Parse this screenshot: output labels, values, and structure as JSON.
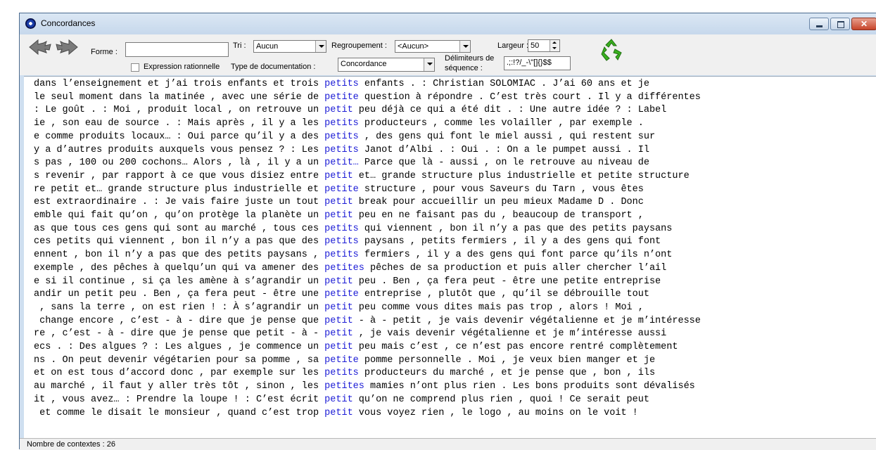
{
  "window": {
    "title": "Concordances"
  },
  "toolbar": {
    "forme_label": "Forme :",
    "forme_value": "",
    "tri_label": "Tri :",
    "tri_value": "Aucun",
    "regroupement_label": "Regroupement :",
    "regroupement_value": "<Aucun>",
    "largeur_label": "Largeur :",
    "largeur_value": "50",
    "regex_label": "Expression rationnelle",
    "doc_type_label": "Type de documentation :",
    "doc_type_value": "Concordance",
    "delim_label_1": "Délimiteurs de",
    "delim_label_2": "séquence :",
    "delim_value": ".;:!?/_-\\\"[]{}$$",
    "icons": [
      "back-arrow-icon",
      "forward-arrow-icon",
      "recycle-icon"
    ]
  },
  "concordances": [
    {
      "left": "dans l’enseignement et j’ai trois enfants et trois ",
      "kw": "petits",
      "right": " enfants . : Christian SOLOMIAC . J’ai 60 ans et je"
    },
    {
      "left": "le seul moment dans la matinée , avec une série de ",
      "kw": "petite",
      "right": " question à répondre . C’est très court . Il y a différentes"
    },
    {
      "left": ": Le goût . : Moi , produit local , on retrouve un ",
      "kw": "petit",
      "right": " peu déjà ce qui a été dit . : Une autre idée ? : Label"
    },
    {
      "left": "ie , son eau de source . : Mais après , il y a les ",
      "kw": "petits",
      "right": " producteurs , comme les volailler , par exemple ."
    },
    {
      "left": "e comme produits locaux… : Oui parce qu’il y a des ",
      "kw": "petits",
      "right": " , des gens qui font le miel aussi , qui restent sur"
    },
    {
      "left": "y a d’autres produits auxquels vous pensez ? : Les ",
      "kw": "petits",
      "right": " Janot d’Albi . : Oui . : On a le pumpet aussi . Il"
    },
    {
      "left": "s pas , 100 ou 200 cochons… Alors , là , il y a un ",
      "kw": "petit…",
      "right": " Parce que là - aussi , on le retrouve au niveau de"
    },
    {
      "left": "s revenir , par rapport à ce que vous disiez entre ",
      "kw": "petit",
      "right": " et… grande structure plus industrielle et petite structure"
    },
    {
      "left": "re petit et… grande structure plus industrielle et ",
      "kw": "petite",
      "right": " structure , pour vous Saveurs du Tarn , vous êtes"
    },
    {
      "left": "est extraordinaire . : Je vais faire juste un tout ",
      "kw": "petit",
      "right": " break pour accueillir un peu mieux Madame D . Donc"
    },
    {
      "left": "emble qui fait qu’on , qu’on protège la planète un ",
      "kw": "petit",
      "right": " peu en ne faisant pas du , beaucoup de transport ,"
    },
    {
      "left": "as que tous ces gens qui sont au marché , tous ces ",
      "kw": "petits",
      "right": " qui viennent , bon il n’y a pas que des petits paysans"
    },
    {
      "left": "ces petits qui viennent , bon il n’y a pas que des ",
      "kw": "petits",
      "right": " paysans , petits fermiers , il y a des gens qui font"
    },
    {
      "left": "ennent , bon il n’y a pas que des petits paysans , ",
      "kw": "petits",
      "right": " fermiers , il y a des gens qui font parce qu’ils n’ont"
    },
    {
      "left": "exemple , des pêches à quelqu’un qui va amener des ",
      "kw": "petites",
      "right": " pêches de sa production et puis aller chercher l’ail"
    },
    {
      "left": "e si il continue , si ça les amène à s’agrandir un ",
      "kw": "petit",
      "right": " peu . Ben , ça fera peut - être une petite entreprise"
    },
    {
      "left": "andir un petit peu . Ben , ça fera peut - être une ",
      "kw": "petite",
      "right": " entreprise , plutôt que , qu’il se débrouille tout"
    },
    {
      "left": " , sans la terre , on est rien ! : À s’agrandir un ",
      "kw": "petit",
      "right": " peu comme vous dites mais pas trop , alors ! Moi ,"
    },
    {
      "left": " change encore , c’est - à - dire que je pense que ",
      "kw": "petit",
      "right": " - à - petit , je vais devenir végétalienne et je m’intéresse"
    },
    {
      "left": "re , c’est - à - dire que je pense que petit - à - ",
      "kw": "petit",
      "right": " , je vais devenir végétalienne et je m’intéresse aussi"
    },
    {
      "left": "ecs . : Des algues ? : Les algues , je commence un ",
      "kw": "petit",
      "right": " peu mais c’est , ce n’est pas encore rentré complètement"
    },
    {
      "left": "ns . On peut devenir végétarien pour sa pomme , sa ",
      "kw": "petite",
      "right": " pomme personnelle . Moi , je veux bien manger et je"
    },
    {
      "left": "et on est tous d’accord donc , par exemple sur les ",
      "kw": "petits",
      "right": " producteurs du marché , et je pense que , bon , ils"
    },
    {
      "left": "au marché , il faut y aller très tôt , sinon , les ",
      "kw": "petites",
      "right": " mamies n’ont plus rien . Les bons produits sont dévalisés"
    },
    {
      "left": "it , vous avez… : Prendre la loupe ! : C’est écrit ",
      "kw": "petit",
      "right": " qu’on ne comprend plus rien , quoi ! Ce serait peut"
    },
    {
      "left": " et comme le disait le monsieur , quand c’est trop ",
      "kw": "petit",
      "right": " vous voyez rien , le logo , au moins on le voit !"
    }
  ],
  "status": {
    "text": "Nombre de contextes : 26"
  },
  "colors": {
    "keyword": "#1b1bd6"
  }
}
